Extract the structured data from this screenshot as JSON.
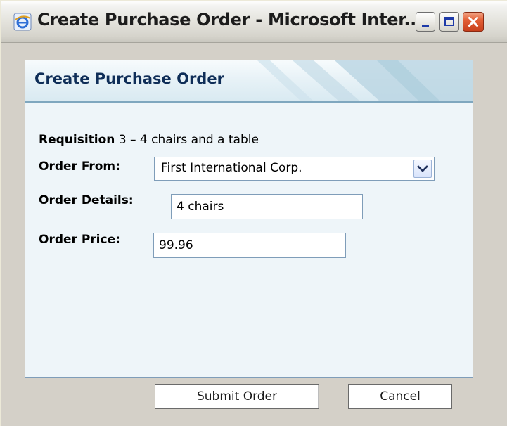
{
  "window": {
    "title": "Create Purchase Order - Microsoft Inter..."
  },
  "dialog": {
    "title": "Create Purchase Order",
    "requisition": {
      "label": "Requisition",
      "value": "3 – 4 chairs and a table"
    },
    "order_from": {
      "label": "Order From:",
      "selected": "First International Corp."
    },
    "order_details": {
      "label": "Order Details:",
      "value": "4 chairs"
    },
    "order_price": {
      "label": "Order Price:",
      "value": "99.96"
    }
  },
  "buttons": {
    "submit": "Submit Order",
    "cancel": "Cancel"
  },
  "icons": {
    "app": "internet-explorer-icon",
    "minimize": "minimize-icon",
    "maximize": "maximize-icon",
    "close": "close-icon",
    "dropdown": "chevron-down-icon"
  },
  "colors": {
    "panel_title": "#0f2e58",
    "close_button": "#e35f35",
    "field_border": "#7f9db9"
  }
}
